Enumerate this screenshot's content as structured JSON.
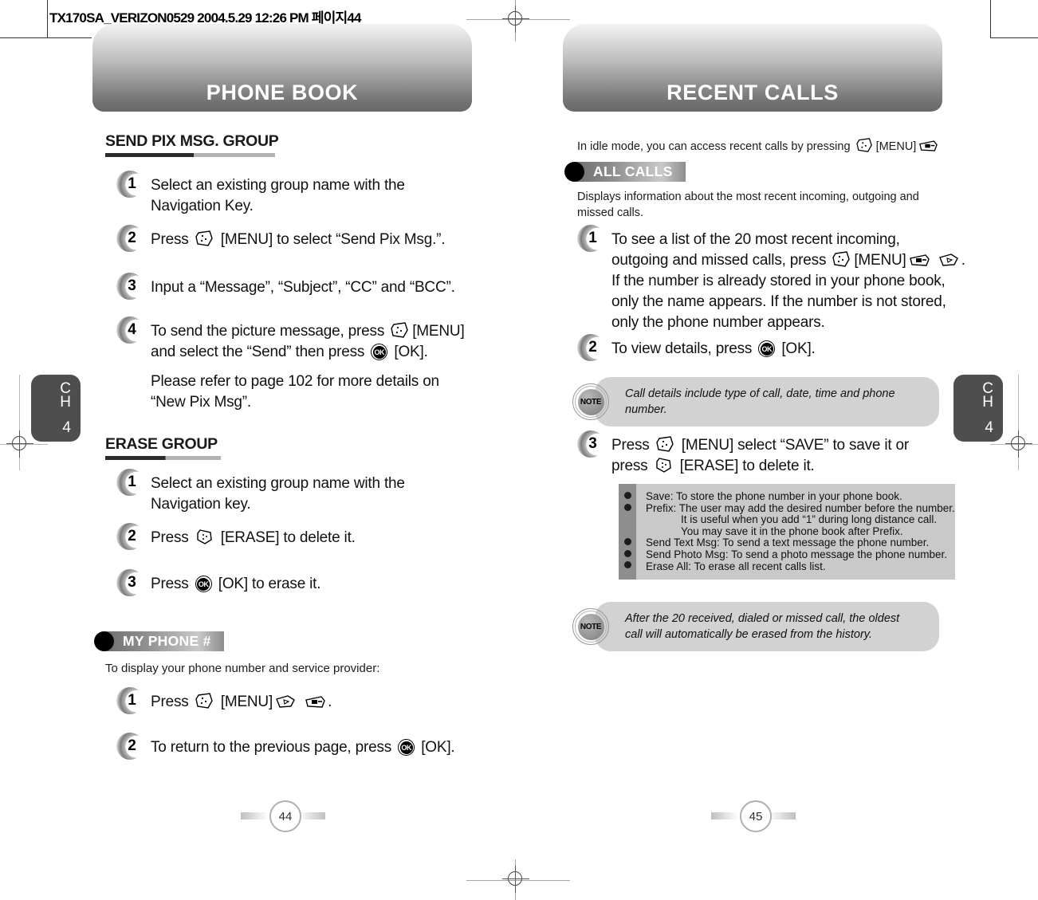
{
  "document": {
    "fileinfo": "TX170SA_VERIZON0529  2004.5.29 12:26 PM  페이지44"
  },
  "left_page": {
    "banner_title": "PHONE BOOK",
    "page_number": "44",
    "chapter_tab": {
      "ch_line1": "C",
      "ch_line2": "H",
      "number": "4"
    },
    "sections": [
      {
        "heading": "SEND PIX MSG. GROUP",
        "steps": [
          {
            "num": "1",
            "lines": [
              "Select an existing group name with the Navigation Key."
            ]
          },
          {
            "num": "2",
            "lines": [
              "Press {menu} [MENU] to select “Send Pix Msg.”."
            ]
          },
          {
            "num": "3",
            "lines": [
              "Input a “Message”, “Subject”, “CC” and “BCC”."
            ]
          },
          {
            "num": "4",
            "lines": [
              "To send the picture message, press {menu} [MENU] and select the “Send” then press {ok} [OK].",
              "Please refer to page 102 for more details on “New Pix Msg”."
            ]
          }
        ]
      },
      {
        "heading": "ERASE GROUP",
        "steps": [
          {
            "num": "1",
            "lines": [
              "Select an existing group name with the Navigation key."
            ]
          },
          {
            "num": "2",
            "lines": [
              "Press {erase} [ERASE] to delete it."
            ]
          },
          {
            "num": "3",
            "lines": [
              "Press {ok} [OK] to erase it."
            ]
          }
        ]
      }
    ],
    "badge": "MY PHONE #",
    "badge_intro": "To display your phone number and service provider:",
    "badge_steps": [
      {
        "num": "1",
        "text": "Press {menu} [MENU] {nav} {num} ."
      },
      {
        "num": "2",
        "text": "To return to the previous page, press {ok} [OK]."
      }
    ]
  },
  "right_page": {
    "banner_title": "RECENT CALLS",
    "page_number": "45",
    "chapter_tab": {
      "ch_line1": "C",
      "ch_line2": "H",
      "number": "4"
    },
    "intro": "In idle mode, you can access recent calls by pressing {menu} [MENU] {num}",
    "badge": "ALL CALLS",
    "badge_desc": "Displays information about the most recent incoming, outgoing and missed calls.",
    "steps": [
      {
        "num": "1",
        "text": "To see a list of the 20 most recent incoming, outgoing and missed calls, press {menu} [MENU] {num} {nav} . If the number is already stored in your phone book, only the name appears. If the number is not stored, only the phone number appears."
      },
      {
        "num": "2",
        "text": "To view details, press {ok} [OK]."
      },
      {
        "num": "3",
        "text": "Press {menu} [MENU] select “SAVE” to save it or press {erase} [ERASE] to delete it."
      }
    ],
    "note_1": "Call details include type of call, date, time and phone number.",
    "note_label": "NOTE",
    "option_list": [
      {
        "bullet": true,
        "text": "Save: To store the phone number in your phone book.",
        "indent": false
      },
      {
        "bullet": true,
        "text": "Prefix: The user may add the desired number before the number.",
        "indent": false
      },
      {
        "bullet": false,
        "text": "It is useful when you add “1” during long distance call.",
        "indent": true
      },
      {
        "bullet": false,
        "text": "You may save it in the phone book after Prefix.",
        "indent": true
      },
      {
        "bullet": true,
        "text": "Send Text Msg: To send a text message the phone number.",
        "indent": false
      },
      {
        "bullet": true,
        "text": "Send Photo Msg: To send a photo message the phone number.",
        "indent": false
      },
      {
        "bullet": true,
        "text": "Erase All: To erase all recent calls list.",
        "indent": false
      }
    ],
    "note_2": "After the 20 received, dialed or missed call, the oldest call will automatically be erased from the history."
  },
  "colors": {
    "banner_top": "#f2f2f2",
    "banner_bottom": "#6a6a6a",
    "note_bubble": "#d2d2d2",
    "list_box": "#c9c9c9",
    "list_gutter": "#8e8e8e",
    "chapter_tab": "#4e4e4e"
  }
}
